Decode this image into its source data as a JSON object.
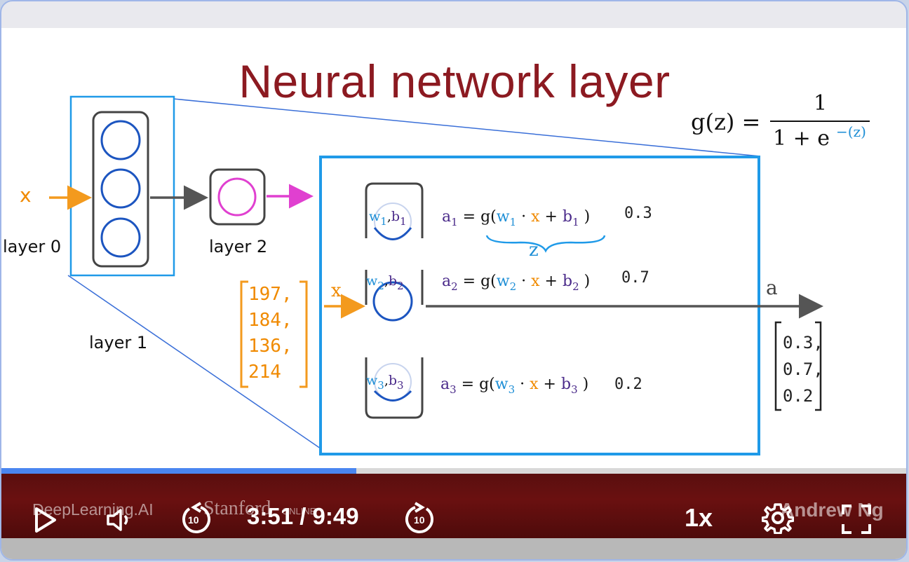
{
  "slide": {
    "title": "Neural network layer",
    "input_label": "x",
    "layer0": "layer 0",
    "layer1": "layer 1",
    "layer2": "layer 2",
    "formula_g": "g(z) =",
    "formula_num": "1",
    "formula_den": "1 + e",
    "formula_exp": "−(z)",
    "input_vector": [
      "197,",
      "184,",
      "136,",
      "214"
    ],
    "neurons": [
      {
        "w": "w",
        "sub": "1",
        "b": "b",
        "eq_a": "a",
        "out": "0.3"
      },
      {
        "w": "w",
        "sub": "2",
        "b": "b",
        "eq_a": "a",
        "out": "0.7"
      },
      {
        "w": "w",
        "sub": "3",
        "b": "b",
        "eq_a": "a",
        "out": "0.2"
      }
    ],
    "z_label": "z",
    "output_label": "a",
    "output_vector": [
      "0.3,",
      "0.7,",
      "0.2"
    ]
  },
  "player": {
    "time_current": "3:51",
    "time_total": "9:49",
    "time_display": "3:51 / 9:49",
    "speed": "1x",
    "progress_fraction": 0.392,
    "watermark_left": "DeepLearning.AI",
    "watermark_mid": "Stanford",
    "watermark_mid2": "ONLINE",
    "watermark_right": "Andrew Ng",
    "skip_back": "10",
    "skip_fwd": "10"
  },
  "colors": {
    "title": "#8c1a21",
    "accent_blue": "#1f9ae8",
    "controls_bg": "#5a0f0f",
    "progress": "#4a86f0"
  }
}
